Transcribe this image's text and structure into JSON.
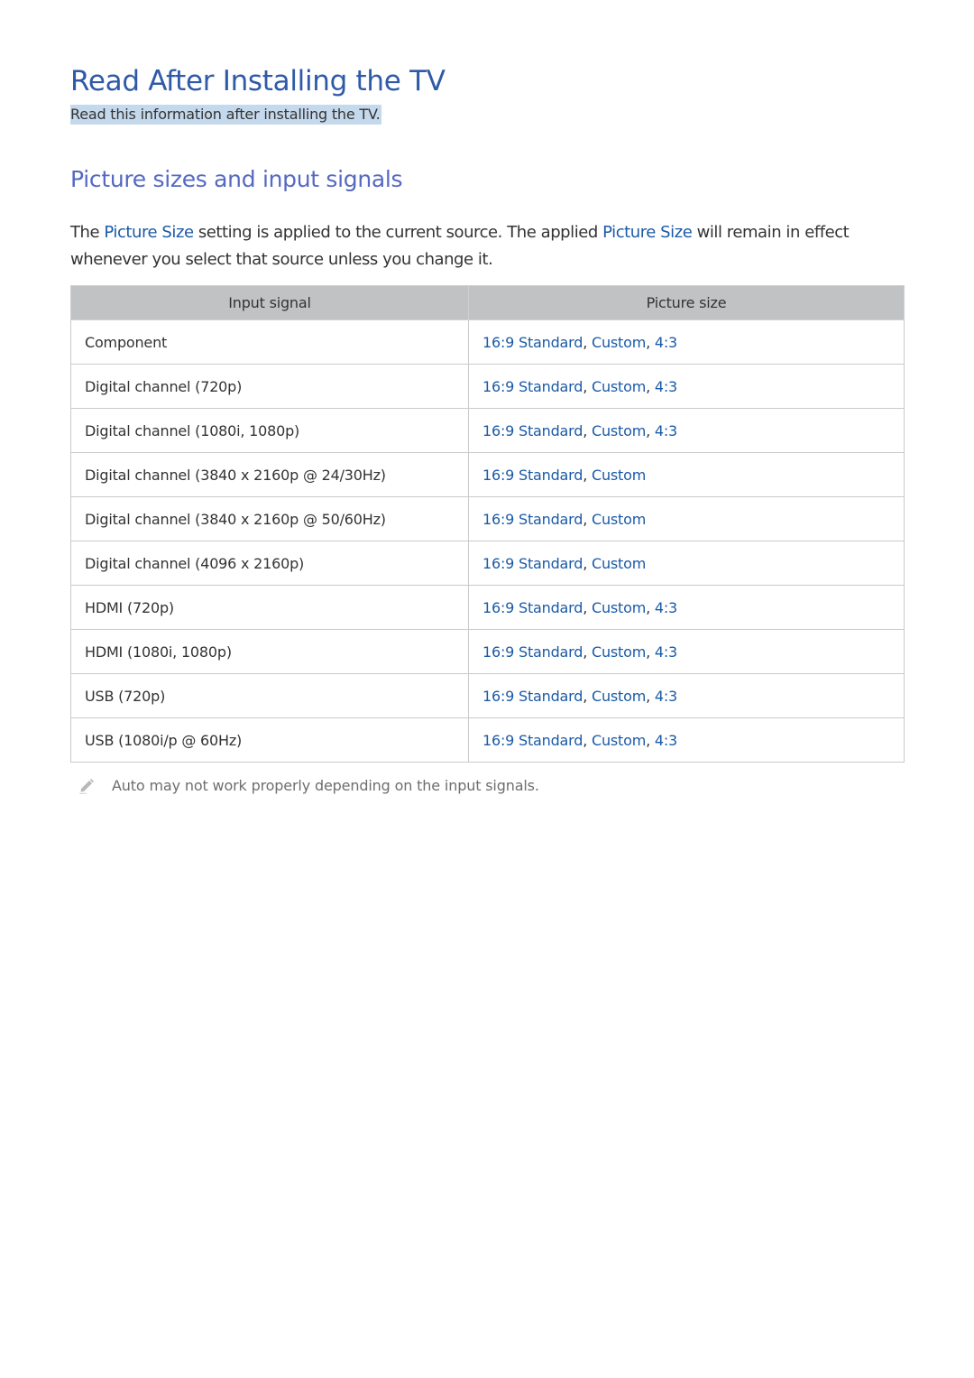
{
  "header": {
    "title": "Read After Installing the TV",
    "subtitle": "Read this information after installing the TV."
  },
  "section": {
    "title": "Picture sizes and input signals",
    "intro": {
      "p1": "The ",
      "link1": "Picture Size",
      "p2": " setting is applied to the current source. The applied ",
      "link2": "Picture Size",
      "p3": " will remain in effect whenever you select that source unless you change it."
    }
  },
  "table": {
    "headers": [
      "Input signal",
      "Picture size"
    ],
    "rows": [
      {
        "signal": "Component",
        "sizes": [
          "16:9 Standard",
          "Custom",
          "4:3"
        ]
      },
      {
        "signal": "Digital channel (720p)",
        "sizes": [
          "16:9 Standard",
          "Custom",
          "4:3"
        ]
      },
      {
        "signal": "Digital channel (1080i, 1080p)",
        "sizes": [
          "16:9 Standard",
          "Custom",
          "4:3"
        ]
      },
      {
        "signal": "Digital channel (3840 x 2160p @ 24/30Hz)",
        "sizes": [
          "16:9 Standard",
          "Custom"
        ]
      },
      {
        "signal": "Digital channel (3840 x 2160p @ 50/60Hz)",
        "sizes": [
          "16:9 Standard",
          "Custom"
        ]
      },
      {
        "signal": "Digital channel (4096 x 2160p)",
        "sizes": [
          "16:9 Standard",
          "Custom"
        ]
      },
      {
        "signal": "HDMI (720p)",
        "sizes": [
          "16:9 Standard",
          "Custom",
          "4:3"
        ]
      },
      {
        "signal": "HDMI (1080i, 1080p)",
        "sizes": [
          "16:9 Standard",
          "Custom",
          "4:3"
        ]
      },
      {
        "signal": "USB (720p)",
        "sizes": [
          "16:9 Standard",
          "Custom",
          "4:3"
        ]
      },
      {
        "signal": "USB (1080i/p @ 60Hz)",
        "sizes": [
          "16:9 Standard",
          "Custom",
          "4:3"
        ]
      }
    ]
  },
  "note": {
    "icon": "pencil-icon",
    "text": "Auto may not work properly depending on the input signals."
  },
  "colors": {
    "title": "#2f5aa8",
    "section": "#5569c3",
    "link": "#1a5aa6",
    "highlight": "#c5d9ec",
    "table_header": "#c1c2c4"
  }
}
